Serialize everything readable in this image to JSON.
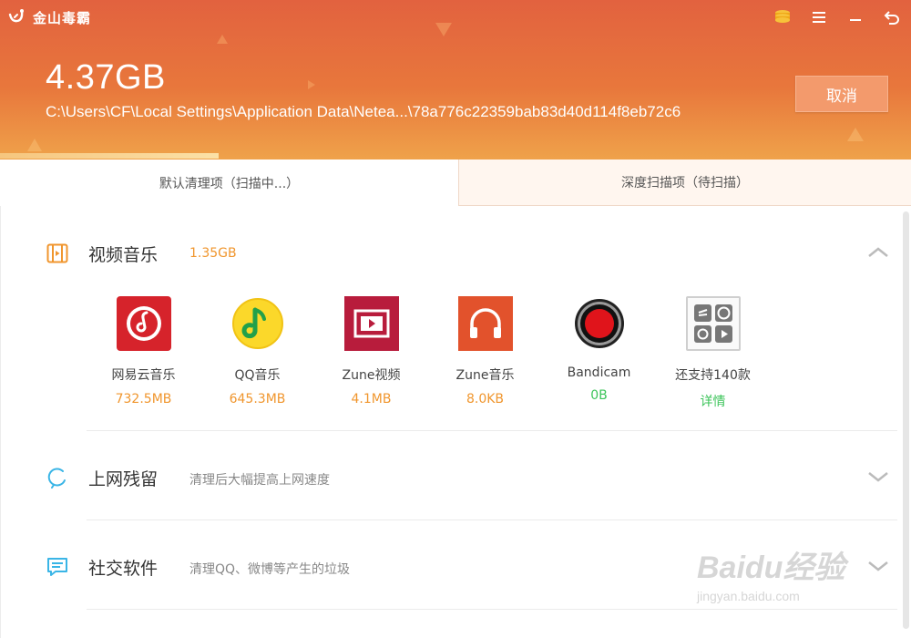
{
  "app": {
    "title": "金山毒霸"
  },
  "header": {
    "total_size": "4.37GB",
    "current_path": "C:\\Users\\CF\\Local Settings\\Application Data\\Netea...\\78a776c22359bab83d40d114f8eb72c6",
    "cancel_label": "取消",
    "icons": [
      "coins-icon",
      "menu-icon",
      "minimize-icon",
      "back-icon"
    ]
  },
  "tabs": [
    {
      "label": "默认清理项（扫描中...）",
      "active": true
    },
    {
      "label": "深度扫描项（待扫描）",
      "active": false
    }
  ],
  "sections": [
    {
      "title": "视频音乐",
      "desc": "1.35GB",
      "icon": "video-icon",
      "expanded": true
    },
    {
      "title": "上网残留",
      "desc": "清理后大幅提高上网速度",
      "icon": "browser-icon",
      "expanded": false
    },
    {
      "title": "社交软件",
      "desc": "清理QQ、微博等产生的垃圾",
      "icon": "chat-icon",
      "expanded": false
    }
  ],
  "apps": [
    {
      "name": "网易云音乐",
      "size": "732.5MB",
      "icon": "netease-music-icon"
    },
    {
      "name": "QQ音乐",
      "size": "645.3MB",
      "icon": "qq-music-icon"
    },
    {
      "name": "Zune视频",
      "size": "4.1MB",
      "icon": "zune-video-icon"
    },
    {
      "name": "Zune音乐",
      "size": "8.0KB",
      "icon": "zune-music-icon"
    },
    {
      "name": "Bandicam",
      "size": "0B",
      "icon": "bandicam-icon"
    },
    {
      "name": "还支持140款",
      "size": "详情",
      "icon": "more-apps-icon"
    }
  ],
  "watermark": {
    "line1": "Baidu经验",
    "line2": "jingyan.baidu.com"
  },
  "colors": {
    "header_top": "#e2623f",
    "header_bottom": "#efa24a",
    "accent_orange": "#f0962e",
    "accent_green": "#3cc45a"
  }
}
